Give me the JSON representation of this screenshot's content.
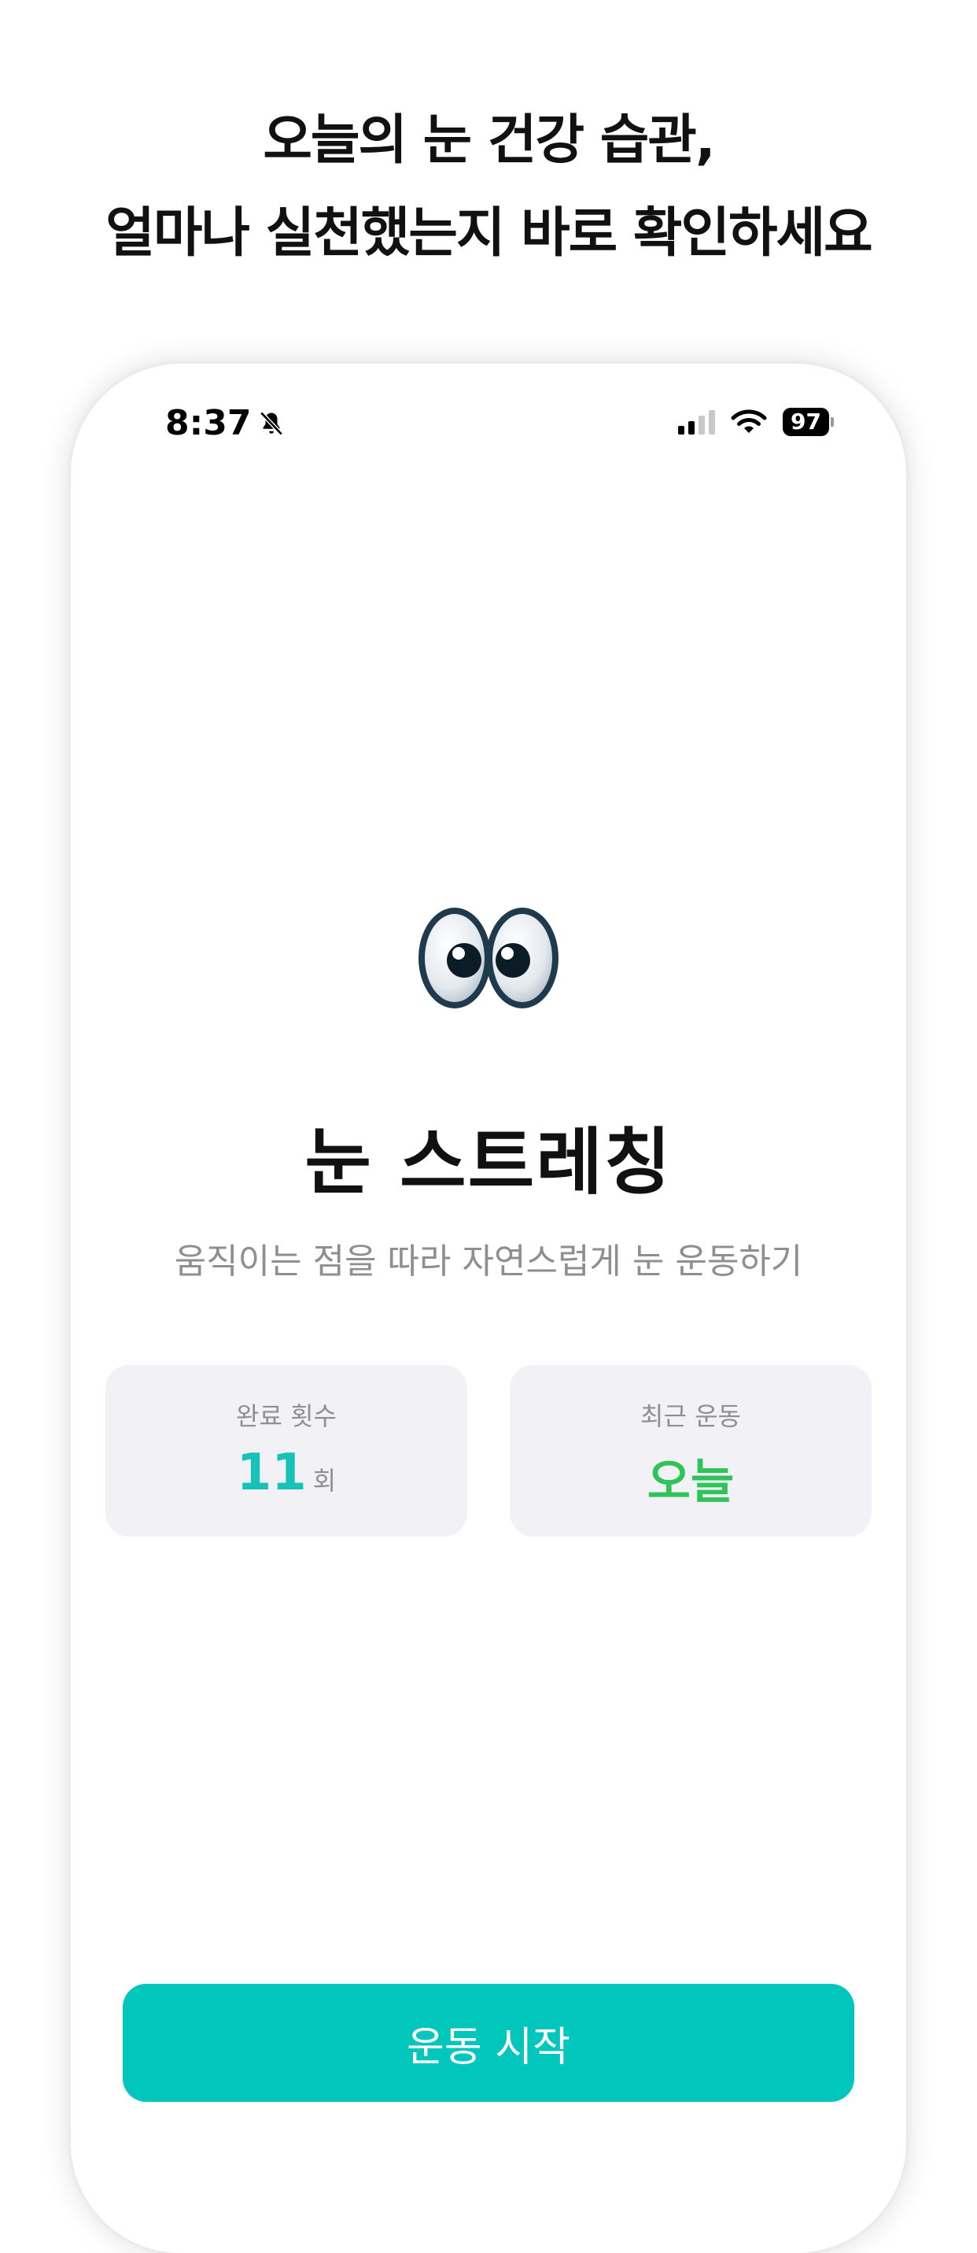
{
  "headline": {
    "line1": "오늘의 눈 건강 습관,",
    "line2": "얼마나 실천했는지 바로 확인하세요"
  },
  "status_bar": {
    "time": "8:37",
    "battery": "97",
    "icons": [
      "bell-slash-icon",
      "signal-icon",
      "wifi-icon",
      "battery-icon"
    ]
  },
  "main": {
    "emoji_icon": "eyes-icon",
    "title": "눈 스트레칭",
    "subtitle": "움직이는 점을 따라 자연스럽게 눈 운동하기"
  },
  "stats": {
    "count": {
      "label": "완료 횟수",
      "value": "11",
      "unit": "회"
    },
    "recent": {
      "label": "최근 운동",
      "value": "오늘"
    }
  },
  "start_button": {
    "label": "운동 시작"
  },
  "colors": {
    "accent": "#00c6bc",
    "count_value": "#18c2b9",
    "recent_value": "#2fc35a",
    "card_bg": "#f2f2f6",
    "muted_text": "#8e8e93"
  }
}
